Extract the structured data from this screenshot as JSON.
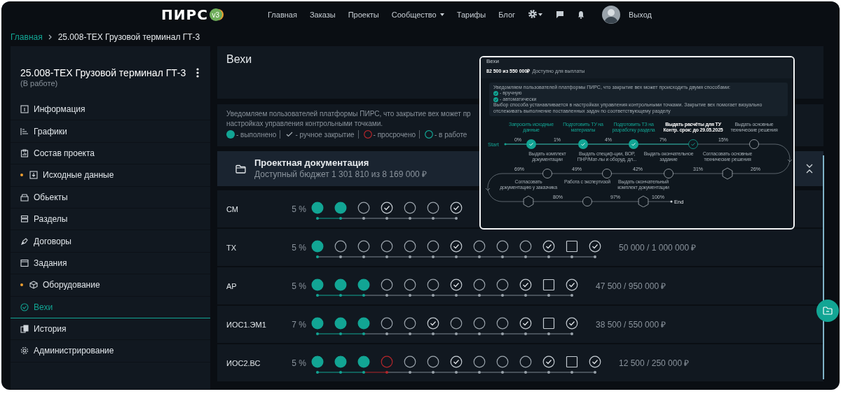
{
  "header": {
    "logo": "ПИРС",
    "version": "v3",
    "nav": [
      {
        "label": "Главная",
        "dropdown": false
      },
      {
        "label": "Заказы",
        "dropdown": false
      },
      {
        "label": "Проекты",
        "dropdown": false
      },
      {
        "label": "Сообщество",
        "dropdown": true
      },
      {
        "label": "Тарифы",
        "dropdown": false
      },
      {
        "label": "Блог",
        "dropdown": false
      }
    ],
    "logout": "Выход"
  },
  "breadcrumb": [
    {
      "label": "Главная",
      "link": true
    },
    {
      "label": "25.008-ТЕХ Грузовой терминал ГТ-3",
      "link": false
    }
  ],
  "sidebar": {
    "title": "25.008-ТЕХ Грузовой терминал ГТ-3",
    "status": "(В работе)",
    "items": [
      {
        "label": "Информация",
        "dot": false,
        "selected": false
      },
      {
        "label": "Графики",
        "dot": false,
        "selected": false
      },
      {
        "label": "Состав проекта",
        "dot": false,
        "selected": false
      },
      {
        "label": "Исходные данные",
        "dot": true,
        "selected": false
      },
      {
        "label": "Обьекты",
        "dot": false,
        "selected": false
      },
      {
        "label": "Разделы",
        "dot": false,
        "selected": false
      },
      {
        "label": "Договоры",
        "dot": false,
        "selected": false
      },
      {
        "label": "Задания",
        "dot": false,
        "selected": false
      },
      {
        "label": "Оборудование",
        "dot": true,
        "selected": false
      },
      {
        "label": "Вехи",
        "dot": false,
        "selected": true
      },
      {
        "label": "История",
        "dot": false,
        "selected": false
      },
      {
        "label": "Администрирование",
        "dot": false,
        "selected": false
      }
    ]
  },
  "page_title": "Вехи",
  "notice": {
    "lines": [
      "Уведомляем пользователей платформы ПИРС, что закрытие вех может пр",
      "настройках управления контрольными точками."
    ],
    "legend": [
      {
        "kind": "done",
        "label": "- выполнено"
      },
      {
        "kind": "check",
        "label": "- ручное закрытие"
      },
      {
        "kind": "overdue",
        "label": "- просрочено"
      },
      {
        "kind": "open",
        "label": "- в работе"
      }
    ]
  },
  "section": {
    "title": "Проектная документация",
    "budget": "Доступный бюджет 1 301 810 из 8 169 000 ₽"
  },
  "rows": [
    {
      "name": "СМ",
      "percent": "5 %",
      "milestones": [
        {
          "kind": "done"
        },
        {
          "kind": "done"
        },
        {
          "kind": "open"
        },
        {
          "kind": "check"
        },
        {
          "kind": "open"
        },
        {
          "kind": "open"
        },
        {
          "kind": "check"
        }
      ]
    },
    {
      "name": "ТХ",
      "percent": "5 %",
      "milestones": [
        {
          "kind": "done"
        },
        {
          "kind": "open"
        },
        {
          "kind": "open"
        },
        {
          "kind": "open"
        },
        {
          "kind": "open"
        },
        {
          "kind": "open"
        },
        {
          "kind": "check"
        },
        {
          "kind": "open"
        },
        {
          "kind": "open"
        },
        {
          "kind": "open"
        },
        {
          "kind": "check"
        },
        {
          "kind": "square"
        },
        {
          "kind": "check"
        }
      ],
      "amount": "50 000 / 1 000 000 ₽"
    },
    {
      "name": "АР",
      "percent": "5 %",
      "milestones": [
        {
          "kind": "done"
        },
        {
          "kind": "done"
        },
        {
          "kind": "done"
        },
        {
          "kind": "open"
        },
        {
          "kind": "open"
        },
        {
          "kind": "open"
        },
        {
          "kind": "check"
        },
        {
          "kind": "open"
        },
        {
          "kind": "open"
        },
        {
          "kind": "check"
        },
        {
          "kind": "square"
        },
        {
          "kind": "check"
        }
      ],
      "amount": "47 500 / 950 000 ₽"
    },
    {
      "name": "ИОС1.ЭМ1",
      "percent": "7 %",
      "milestones": [
        {
          "kind": "done"
        },
        {
          "kind": "done"
        },
        {
          "kind": "done"
        },
        {
          "kind": "open"
        },
        {
          "kind": "open"
        },
        {
          "kind": "check"
        },
        {
          "kind": "open"
        },
        {
          "kind": "open"
        },
        {
          "kind": "open"
        },
        {
          "kind": "check"
        },
        {
          "kind": "square"
        },
        {
          "kind": "check"
        }
      ],
      "amount": "38 500 / 550 000 ₽"
    },
    {
      "name": "ИОС2.ВС",
      "percent": "5 %",
      "milestones": [
        {
          "kind": "done"
        },
        {
          "kind": "done"
        },
        {
          "kind": "done"
        },
        {
          "kind": "overdue"
        },
        {
          "kind": "open"
        },
        {
          "kind": "open"
        },
        {
          "kind": "check"
        },
        {
          "kind": "open"
        },
        {
          "kind": "open"
        },
        {
          "kind": "open"
        },
        {
          "kind": "check"
        },
        {
          "kind": "square"
        },
        {
          "kind": "check"
        }
      ],
      "amount": "12 500 / 250 000 ₽"
    }
  ],
  "overlay": {
    "title": "Вехи",
    "amount": "82 500 из 550 000₽",
    "amount_note": "Доступно для выплаты",
    "notice_head": "Уведомляем пользователей платформы ПИРС, что закрытие вех может происходить двумя способами:",
    "options": [
      "- вручную",
      "- автоматически"
    ],
    "notice_tail": "Выбор способа устанавливается в настройках управления контрольными точками. Закрытие вех помогает визуально отслеживать выполнение поставленных задач по соответствующему разделу",
    "start": "Start",
    "end": "End",
    "nodes": [
      {
        "kind": "done",
        "label": [
          "Запросить исходные",
          "данные"
        ]
      },
      {
        "kind": "done",
        "label": [
          "Подготовить ТУ на",
          "материалы"
        ]
      },
      {
        "kind": "done",
        "label": [
          "Подготовить ТЗ на",
          "разработку раздела"
        ]
      },
      {
        "kind": "check",
        "label": [
          "Выдать расчёты для ТУ",
          "Контр. срок: до 29.05.2025"
        ]
      },
      {
        "kind": "open",
        "label": [
          "Выдать основные",
          "технические решения"
        ]
      },
      {
        "kind": "open",
        "label": [
          "Выдать комплект",
          "документации"
        ]
      },
      {
        "kind": "open",
        "label": [
          "Выдать специф-ции, ВОР,",
          "ПНР/Мат-лы и оборуд. дл..."
        ]
      },
      {
        "kind": "open",
        "label": [
          "Выдать окончательное",
          "задание"
        ]
      },
      {
        "kind": "hex",
        "label": [
          "Согласовать основные",
          "технические решения"
        ]
      },
      {
        "kind": "hex",
        "label": [
          "Согласовать",
          "документацию у заказчика"
        ]
      },
      {
        "kind": "open",
        "label": [
          "Работа с экспертизой"
        ]
      },
      {
        "kind": "hex",
        "label": [
          "Выдать окончательный",
          "комплект документации"
        ]
      }
    ],
    "percents": [
      "0%",
      "1%",
      "4%",
      "7%",
      "15%",
      "69%",
      "49%",
      "42%",
      "31%",
      "26%",
      "80%",
      "97%",
      "100%"
    ]
  }
}
